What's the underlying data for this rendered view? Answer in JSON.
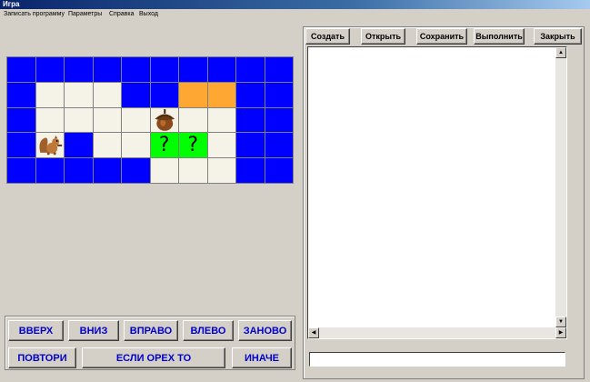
{
  "window": {
    "title": "Игра"
  },
  "menu": [
    {
      "label": "Записать программу"
    },
    {
      "label": "Параметры"
    },
    {
      "label": "Справка"
    },
    {
      "label": "Выход"
    }
  ],
  "colors": {
    "wall": "#0000ff",
    "floor": "#f5f2e8",
    "target": "#ffa733",
    "unknown": "#00ff00"
  },
  "grid": {
    "rows": [
      [
        "wall",
        "wall",
        "wall",
        "wall",
        "wall",
        "wall",
        "wall",
        "wall",
        "wall",
        "wall"
      ],
      [
        "wall",
        "floor",
        "floor",
        "floor",
        "wall",
        "wall",
        "target",
        "target",
        "wall",
        "wall"
      ],
      [
        "wall",
        "floor",
        "floor",
        "floor",
        "floor",
        "acorn",
        "floor",
        "floor",
        "wall",
        "wall"
      ],
      [
        "wall",
        "squirrel",
        "wall",
        "floor",
        "floor",
        "unknown",
        "unknown",
        "floor",
        "wall",
        "wall"
      ],
      [
        "wall",
        "wall",
        "wall",
        "wall",
        "wall",
        "floor",
        "floor",
        "floor",
        "wall",
        "wall"
      ]
    ],
    "unknown_symbol": "?"
  },
  "toolbar": [
    {
      "label": "Создать"
    },
    {
      "label": "Открыть"
    },
    {
      "label": "Сохранить"
    },
    {
      "label": "Выполнить"
    },
    {
      "label": "Закрыть"
    }
  ],
  "commands": {
    "up": "ВВЕРХ",
    "down": "ВНИЗ",
    "right": "ВПРАВО",
    "left": "ВЛЕВО",
    "restart": "ЗАНОВО",
    "repeat": "ПОВТОРИ",
    "if_nut": "ЕСЛИ ОРЕХ ТО",
    "else": "ИНАЧЕ"
  },
  "editor": {
    "text": ""
  },
  "command_line": {
    "value": ""
  }
}
